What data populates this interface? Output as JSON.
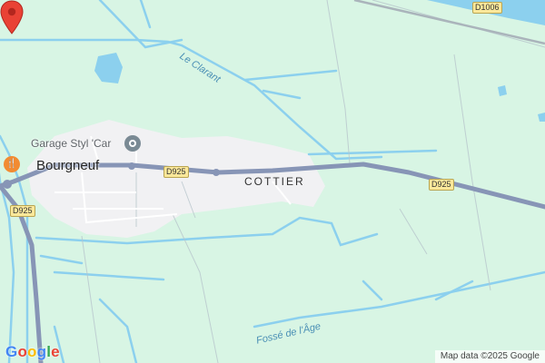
{
  "map": {
    "places": {
      "town": "Bourgneuf",
      "hamlet": "COTTIER"
    },
    "poi": {
      "garage": "Garage Styl 'Car"
    },
    "waterways": {
      "river": "Le Clarant",
      "ditch": "Fossé de l'Âge"
    },
    "road_shields": [
      "D925",
      "D925",
      "D925",
      "D1006"
    ],
    "icons": {
      "garage": "garage-icon",
      "restaurant": "restaurant-icon",
      "marker": "location-pin-icon"
    },
    "colors": {
      "land": "#d8f5e4",
      "water": "#8cd0ee",
      "built_area": "#f1f1f3",
      "road": "#8795b6",
      "marker": "#e94235"
    }
  },
  "branding": {
    "logo_letters": [
      {
        "char": "G",
        "color": "#4285F4"
      },
      {
        "char": "o",
        "color": "#EA4335"
      },
      {
        "char": "o",
        "color": "#FBBC05"
      },
      {
        "char": "g",
        "color": "#4285F4"
      },
      {
        "char": "l",
        "color": "#34A853"
      },
      {
        "char": "e",
        "color": "#EA4335"
      }
    ],
    "attribution": "Map data ©2025 Google"
  }
}
